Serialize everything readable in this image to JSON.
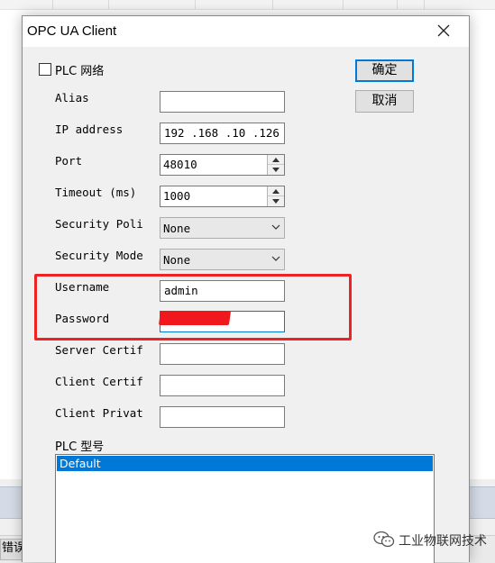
{
  "dialog": {
    "title": "OPC UA Client",
    "ok_label": "确定",
    "cancel_label": "取消",
    "plc_network_label": "PLC 网络",
    "plc_network_checked": false
  },
  "fields": {
    "alias": {
      "label": "Alias",
      "value": ""
    },
    "ip": {
      "label": "IP address",
      "value": "192 .168 .10 .126"
    },
    "port": {
      "label": "Port",
      "value": "48010"
    },
    "timeout": {
      "label": "Timeout (ms)",
      "value": "1000"
    },
    "security_policy": {
      "label": "Security Poli",
      "value": "None"
    },
    "security_mode": {
      "label": "Security Mode",
      "value": "None"
    },
    "username": {
      "label": "Username",
      "value": "admin"
    },
    "password": {
      "label": "Password",
      "value": ""
    },
    "server_cert": {
      "label": "Server Certif",
      "value": ""
    },
    "client_cert": {
      "label": "Client Certif",
      "value": ""
    },
    "client_private": {
      "label": "Client Privat",
      "value": ""
    }
  },
  "plc_model": {
    "label": "PLC 型号",
    "items": [
      "Default"
    ],
    "selected_index": 0
  },
  "background": {
    "tab_first": "错误"
  },
  "watermark": {
    "text": "工业物联网技术"
  },
  "colors": {
    "highlight_border": "#ee2222",
    "selection": "#0078d7",
    "redaction": "#f0181c"
  }
}
